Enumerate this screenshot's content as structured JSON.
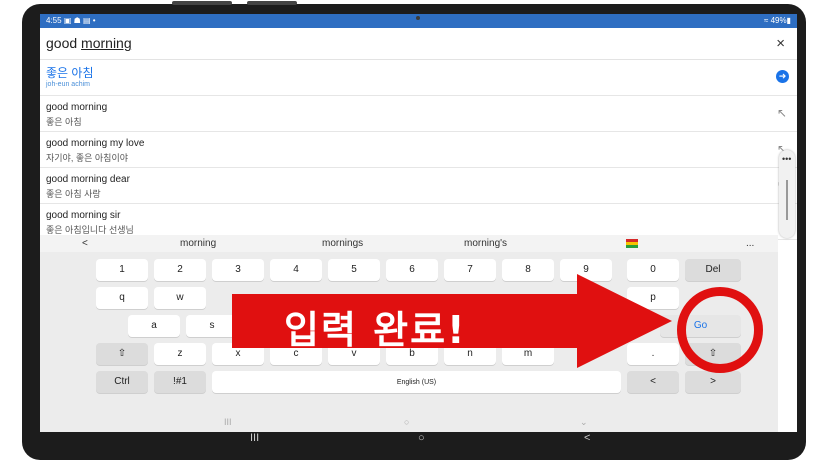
{
  "status": {
    "time": "4:55",
    "icons": "▣ ☗ ▤ •",
    "battery": "≈ 49%▮"
  },
  "search": {
    "query_plain": "good ",
    "query_underlined": "morning",
    "close": "×"
  },
  "top_result": {
    "text": "좋은 아침",
    "romanization": "joh-eun achim",
    "icon": "➜"
  },
  "results": [
    {
      "en": "good morning",
      "ko": "좋은 아침",
      "arrow": "↖"
    },
    {
      "en": "good morning my love",
      "ko": "자기야, 좋은 아침이야",
      "arrow": "↖"
    },
    {
      "en": "good morning dear",
      "ko": "좋은 아침 사랑",
      "arrow": "↖"
    },
    {
      "en": "good morning sir",
      "ko": "좋은 아침입니다 선생님",
      "arrow": "↖"
    }
  ],
  "suggestions": {
    "back": "<",
    "s1": "morning",
    "s2": "mornings",
    "s3": "morning's",
    "more": "..."
  },
  "keys": {
    "row1": [
      "1",
      "2",
      "3",
      "4",
      "5",
      "6",
      "7",
      "8",
      "9",
      "0"
    ],
    "del": "Del",
    "row2": [
      "q",
      "w",
      "p"
    ],
    "row3": [
      "a",
      "s"
    ],
    "go": "Go",
    "row4": [
      "z",
      "x",
      "c",
      "v",
      "b",
      "n",
      "m",
      "."
    ],
    "shift": "⇧",
    "ctrl": "Ctrl",
    "sym": "!#1",
    "space": "English (US)",
    "left": "<",
    "right": ">"
  },
  "keyboard_nav": {
    "recents": "III",
    "home": "○",
    "hide": "⌄"
  },
  "system_nav": {
    "recents": "III",
    "home": "○",
    "back": "<"
  },
  "sidepanel": {
    "dots": "•••"
  },
  "overlay": {
    "label": "입력 완료!"
  },
  "colors": {
    "accent": "#1a73e8",
    "overlay_red": "#e01010"
  }
}
